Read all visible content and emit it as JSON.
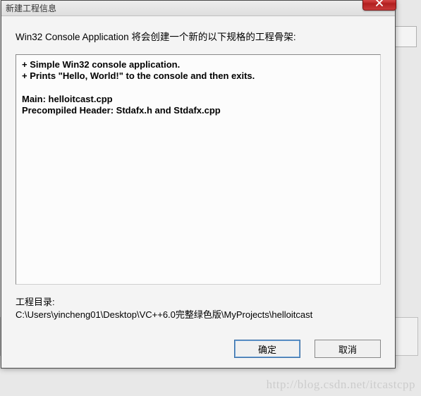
{
  "window": {
    "title": "新建工程信息"
  },
  "content": {
    "intro": "Win32 Console Application 将会创建一个新的以下规格的工程骨架:",
    "info": "+ Simple Win32 console application.\n+ Prints \"Hello, World!\" to the console and then exits.\n\nMain: helloitcast.cpp\nPrecompiled Header: Stdafx.h and Stdafx.cpp",
    "dir_label": "工程目录:",
    "dir_path": "C:\\Users\\yincheng01\\Desktop\\VC++6.0完整绿色版\\MyProjects\\helloitcast"
  },
  "buttons": {
    "ok": "确定",
    "cancel": "取消"
  },
  "watermark": "http://blog.csdn.net/itcastcpp"
}
